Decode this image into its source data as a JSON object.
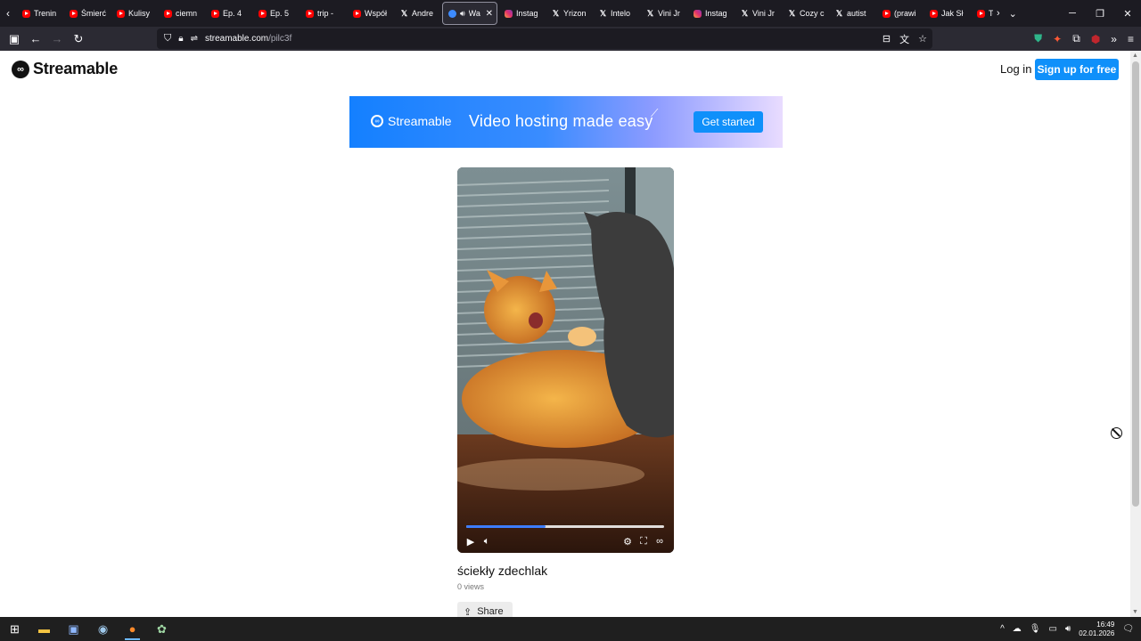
{
  "tabs": [
    {
      "label": "Trenin",
      "icon": "youtube-icon"
    },
    {
      "label": "Śmierć",
      "icon": "youtube-icon"
    },
    {
      "label": "Kulisy",
      "icon": "youtube-icon"
    },
    {
      "label": "ciemn",
      "icon": "youtube-icon"
    },
    {
      "label": "Ep. 4",
      "icon": "youtube-icon"
    },
    {
      "label": "Ep. 5",
      "icon": "youtube-icon"
    },
    {
      "label": "trip -",
      "icon": "youtube-icon"
    },
    {
      "label": "Współ",
      "icon": "youtube-icon"
    },
    {
      "label": "Andre",
      "icon": "x-icon"
    },
    {
      "label": "Wa",
      "icon": "streamable-icon",
      "active": true
    },
    {
      "label": "Instag",
      "icon": "instagram-icon"
    },
    {
      "label": "Yrizon",
      "icon": "x-icon"
    },
    {
      "label": "Intelo",
      "icon": "x-icon"
    },
    {
      "label": "Vini Jr",
      "icon": "x-icon"
    },
    {
      "label": "Instag",
      "icon": "instagram-icon"
    },
    {
      "label": "Vini Jr",
      "icon": "x-icon"
    },
    {
      "label": "Cozy c",
      "icon": "x-icon"
    },
    {
      "label": "autist",
      "icon": "x-icon"
    },
    {
      "label": "(prawi",
      "icon": "youtube-icon"
    },
    {
      "label": "Jak Sł",
      "icon": "youtube-icon"
    },
    {
      "label": "To ju",
      "icon": "youtube-icon"
    }
  ],
  "urlbar": {
    "host": "streamable.com",
    "path": "/pilc3f"
  },
  "site": {
    "logo_text": "Streamable",
    "login_label": "Log in",
    "signup_label": "Sign up for free"
  },
  "banner": {
    "brand": "Streamable",
    "tagline": "Video hosting made easy",
    "cta_label": "Get started"
  },
  "video": {
    "title": "ściekły zdechlak",
    "views": "0 views",
    "progress": 0.4,
    "share_label": "Share"
  },
  "taskbar": {
    "time": "16:49",
    "date": "02.01.2026"
  }
}
